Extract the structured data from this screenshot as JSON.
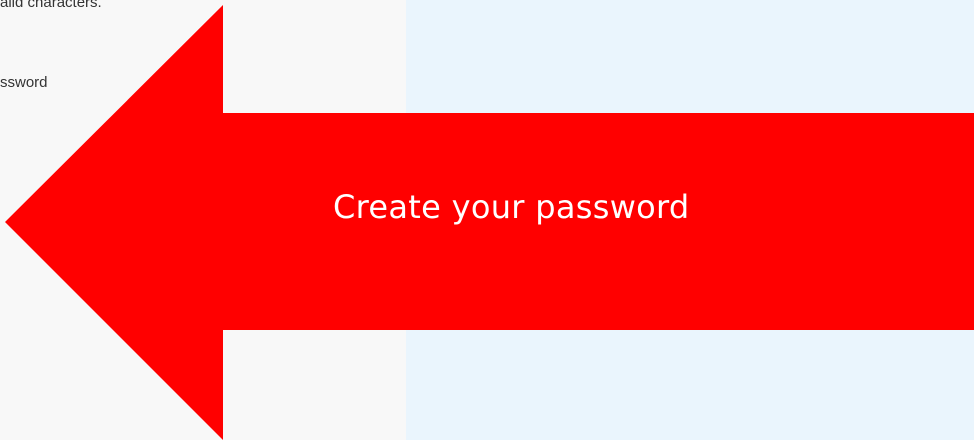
{
  "form": {
    "hint_text": "alid characters.",
    "field_label": "ssword"
  },
  "callout": {
    "text": "Create your password",
    "color": "#ff0000",
    "shape": "left-arrow"
  },
  "colors": {
    "left_background": "#f8f8f8",
    "right_background": "#eaf5fd",
    "callout_text": "#ffffff"
  }
}
